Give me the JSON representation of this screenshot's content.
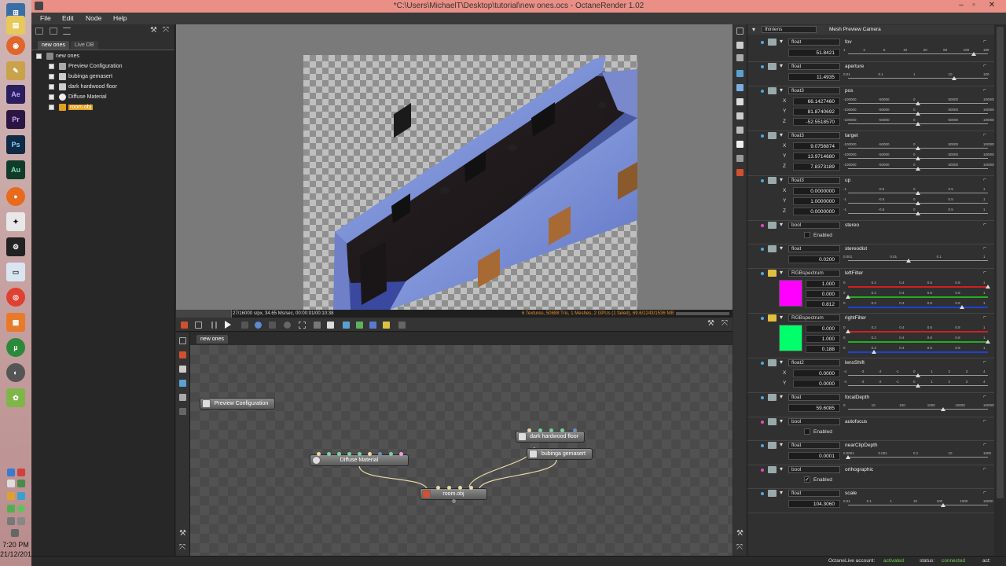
{
  "window": {
    "title": "*C:\\Users\\MichaelT\\Desktop\\tutorial\\new ones.ocs - OctaneRender 1.02"
  },
  "menu": [
    "File",
    "Edit",
    "Node",
    "Help"
  ],
  "taskbar": {
    "time": "7:20 PM",
    "date": "21/12/2012",
    "icons": [
      "Ae",
      "Pr",
      "Ps",
      "Au"
    ]
  },
  "scene": {
    "tabs": [
      "new ones",
      "Live DB"
    ],
    "root": "new ones",
    "items": [
      "Preview Configuration",
      "bubinga gemasert",
      "dark hardwood floor",
      "Diffuse Material",
      "room.obj"
    ]
  },
  "render": {
    "stats": "27/16000 s/px, 34.65 Ms/sec, 00:00:01/00:10:38",
    "info": "6 Textures, 50688 Tris, 1 Meshes, 2 GPUs (1 failed), 69.6/1243/1536 MB",
    "progress_fraction": 0.1
  },
  "nodegraph": {
    "tab": "new ones",
    "nodes": [
      "Preview Configuration",
      "Diffuse Material",
      "dark hardwood floor",
      "bubinga gemasert",
      "room.obj"
    ]
  },
  "camera": {
    "type": "thinlens",
    "name": "Mesh Preview Camera"
  },
  "properties": [
    {
      "key": "fov",
      "type": "float",
      "label": "fov",
      "value": "51.8421",
      "ticks": [
        "1",
        "2",
        "5",
        "10",
        "20",
        "50",
        "100",
        "180"
      ],
      "knob": 0.9
    },
    {
      "key": "aperture",
      "type": "float",
      "label": "aperture",
      "value": "11.4935",
      "ticks": [
        "0.01",
        "0.1",
        "1",
        "10",
        "100"
      ],
      "knob": 0.76
    },
    {
      "key": "pos",
      "type": "float3",
      "label": "pos",
      "rows": [
        {
          "axis": "X",
          "value": "66.1427460"
        },
        {
          "axis": "Y",
          "value": "81.8740692"
        },
        {
          "axis": "Z",
          "value": "-52.5518570"
        }
      ],
      "ticks": [
        "-100000",
        "-50000",
        "0",
        "50000",
        "100000"
      ]
    },
    {
      "key": "target",
      "type": "float3",
      "label": "target",
      "rows": [
        {
          "axis": "X",
          "value": "9.0756874"
        },
        {
          "axis": "Y",
          "value": "13.9714680"
        },
        {
          "axis": "Z",
          "value": "7.8373189"
        }
      ],
      "ticks": [
        "-100000",
        "-50000",
        "0",
        "50000",
        "100000"
      ]
    },
    {
      "key": "up",
      "type": "float3",
      "label": "up",
      "rows": [
        {
          "axis": "X",
          "value": "0.0000000"
        },
        {
          "axis": "Y",
          "value": "1.0000000"
        },
        {
          "axis": "Z",
          "value": "0.0000000"
        }
      ],
      "ticks": [
        "-1",
        "-0.5",
        "0",
        "0.5",
        "1"
      ]
    },
    {
      "key": "stereo",
      "type": "bool",
      "label": "stereo",
      "enabled_label": "Enabled",
      "checked": false
    },
    {
      "key": "stereodist",
      "type": "float",
      "label": "stereodist",
      "value": "0.0200",
      "ticks": [
        "0.001",
        "0.01",
        "0.1",
        "1"
      ],
      "knob": 0.43
    },
    {
      "key": "leftFilter",
      "type": "RGBspectrum",
      "label": "leftFilter",
      "color": "#ff00ff",
      "rows": [
        {
          "value": "1.000"
        },
        {
          "value": "0.000"
        },
        {
          "value": "0.812"
        }
      ],
      "ticks": [
        "0",
        "0.2",
        "0.4",
        "0.6",
        "0.8",
        "1"
      ]
    },
    {
      "key": "rightFilter",
      "type": "RGBspectrum",
      "label": "rightFilter",
      "color": "#00ff6a",
      "rows": [
        {
          "value": "0.000"
        },
        {
          "value": "1.000"
        },
        {
          "value": "0.188"
        }
      ],
      "ticks": [
        "0",
        "0.2",
        "0.4",
        "0.6",
        "0.8",
        "1"
      ]
    },
    {
      "key": "lensShift",
      "type": "float2",
      "label": "lensShift",
      "rows": [
        {
          "axis": "X",
          "value": "0.0000"
        },
        {
          "axis": "Y",
          "value": "0.0000"
        }
      ],
      "ticks": [
        "-4",
        "-3",
        "-2",
        "-1",
        "0",
        "1",
        "2",
        "3",
        "4"
      ]
    },
    {
      "key": "focalDepth",
      "type": "float",
      "label": "focalDepth",
      "value": "59.6085",
      "ticks": [
        "0",
        "10",
        "100",
        "1000",
        "10000",
        "100000"
      ],
      "knob": 0.68
    },
    {
      "key": "autofocus",
      "type": "bool",
      "label": "autofocus",
      "enabled_label": "Enabled",
      "checked": false
    },
    {
      "key": "nearClipDepth",
      "type": "float",
      "label": "nearClipDepth",
      "value": "0.0001",
      "ticks": [
        "0.0001",
        "0.001",
        "0.1",
        "10",
        "1000"
      ],
      "knob": 0.0
    },
    {
      "key": "orthographic",
      "type": "bool",
      "label": "orthographic",
      "enabled_label": "Enabled",
      "checked": true
    },
    {
      "key": "scale",
      "type": "float",
      "label": "scale",
      "value": "104.3060",
      "ticks": [
        "0.01",
        "0.1",
        "1",
        "10",
        "100",
        "1000",
        "10000"
      ],
      "knob": 0.68
    }
  ],
  "status": {
    "account_label": "OctaneLive account:",
    "account_value": "activated",
    "status_label": "status:",
    "status_value": "connected",
    "act_label": "act:"
  }
}
